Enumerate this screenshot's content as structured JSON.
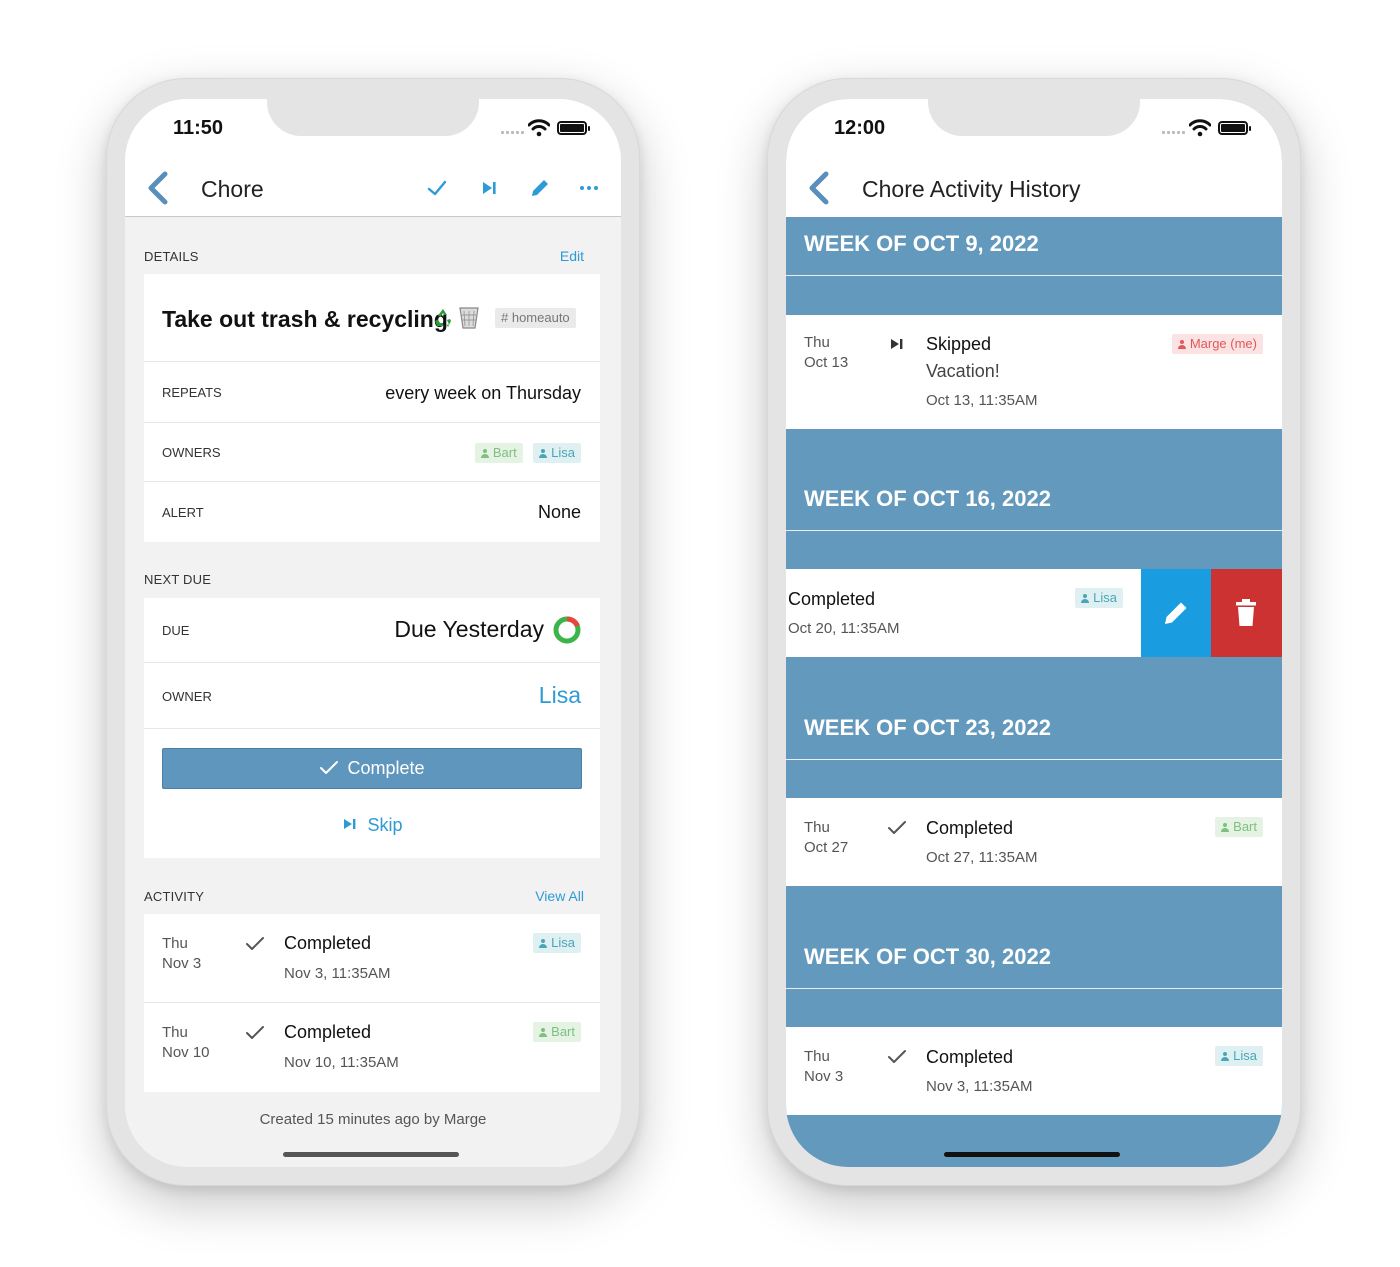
{
  "left": {
    "status": {
      "time": "11:50"
    },
    "nav": {
      "title": "Chore",
      "actions": [
        "checkmark-icon",
        "skip-icon",
        "pencil-icon",
        "more-icon"
      ]
    },
    "details": {
      "section_label": "DETAILS",
      "edit_link": "Edit",
      "chore_title": "Take out trash & recycling",
      "chore_emoji": [
        "recycle-icon",
        "wastebasket-icon"
      ],
      "tag": "homeauto",
      "repeats_label": "REPEATS",
      "repeats_value": "every week on Thursday",
      "owners_label": "OWNERS",
      "owners": [
        "Bart",
        "Lisa"
      ],
      "alert_label": "ALERT",
      "alert_value": "None"
    },
    "next_due": {
      "section_label": "NEXT DUE",
      "due_label": "DUE",
      "due_value": "Due Yesterday",
      "owner_label": "OWNER",
      "owner_value": "Lisa",
      "complete_button": "Complete",
      "skip_button": "Skip"
    },
    "activity": {
      "section_label": "ACTIVITY",
      "view_all": "View All",
      "items": [
        {
          "day": "Thu",
          "date": "Nov 3",
          "title": "Completed",
          "time": "Nov 3, 11:35AM",
          "owner": "Lisa"
        },
        {
          "day": "Thu",
          "date": "Nov 10",
          "title": "Completed",
          "time": "Nov 10, 11:35AM",
          "owner": "Bart"
        }
      ]
    },
    "footer": "Created 15 minutes ago by Marge"
  },
  "right": {
    "status": {
      "time": "12:00"
    },
    "nav": {
      "title": "Chore Activity History"
    },
    "weeks": [
      {
        "title": "WEEK OF OCT 9, 2022"
      },
      {
        "title": "WEEK OF OCT 16, 2022"
      },
      {
        "title": "WEEK OF OCT 23, 2022"
      },
      {
        "title": "WEEK OF OCT 30, 2022"
      }
    ],
    "entries": [
      {
        "day": "Thu",
        "date": "Oct 13",
        "title": "Skipped",
        "note": "Vacation!",
        "time": "Oct 13, 11:35AM",
        "owner": "Marge (me)"
      },
      {
        "title": "Completed",
        "time": "Oct 20, 11:35AM",
        "owner": "Lisa"
      },
      {
        "day": "Thu",
        "date": "Oct 27",
        "title": "Completed",
        "time": "Oct 27, 11:35AM",
        "owner": "Bart"
      },
      {
        "day": "Thu",
        "date": "Nov 3",
        "title": "Completed",
        "time": "Nov 3, 11:35AM",
        "owner": "Lisa"
      }
    ],
    "swipe_actions": [
      "pencil-icon",
      "trash-icon"
    ]
  },
  "colors": {
    "section_blue": "#6499be",
    "link_blue": "#2d9bd6",
    "edit_blue": "#1a9de0",
    "delete_red": "#cc3232"
  }
}
